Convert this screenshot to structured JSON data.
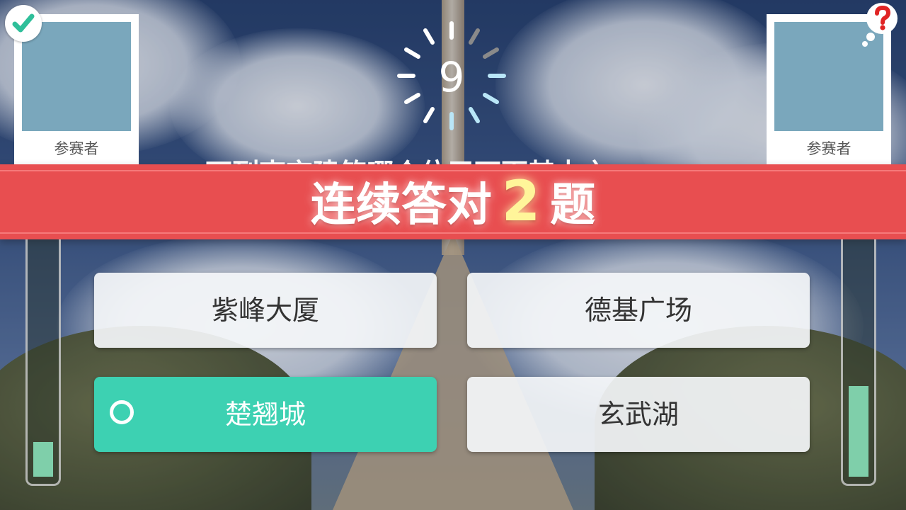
{
  "players": {
    "left": {
      "name": "参赛者",
      "status_icon": "check-icon"
    },
    "right": {
      "name": "参赛者",
      "status_icon": "question-bubble-icon"
    }
  },
  "timer": {
    "seconds": "9"
  },
  "question": {
    "text": "下列南京建筑哪个位于下面其中之一"
  },
  "streak": {
    "prefix": "连续答对",
    "count": "2",
    "suffix": "题"
  },
  "options": [
    {
      "label": "紫峰大厦",
      "selected": false
    },
    {
      "label": "德基广场",
      "selected": false
    },
    {
      "label": "楚翘城",
      "selected": true
    },
    {
      "label": "玄武湖",
      "selected": false
    }
  ],
  "scores": {
    "left_fraction": 0.15,
    "right_fraction": 0.39
  },
  "colors": {
    "banner": "#e84e50",
    "selected": "#3dd1b2",
    "avatar": "#7aa7bc",
    "bar_fill": "#7fcfaa",
    "streak_number": "#fff59a"
  }
}
